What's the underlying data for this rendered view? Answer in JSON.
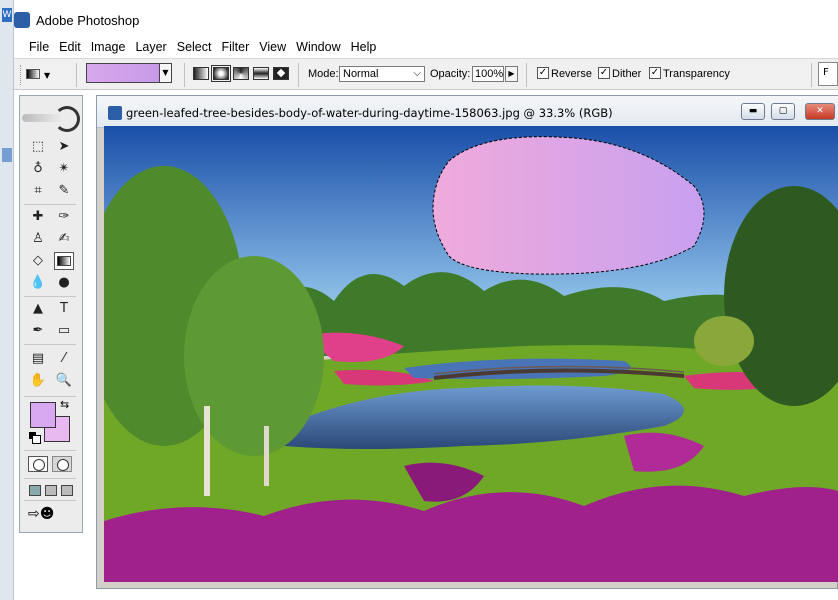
{
  "app": {
    "title": "Adobe Photoshop"
  },
  "menubar": {
    "items": [
      "File",
      "Edit",
      "Image",
      "Layer",
      "Select",
      "Filter",
      "View",
      "Window",
      "Help"
    ]
  },
  "options": {
    "mode_label": "Mode:",
    "mode_value": "Normal",
    "opacity_label": "Opacity:",
    "opacity_value": "100%",
    "reverse_label": "Reverse",
    "dither_label": "Dither",
    "transparency_label": "Transparency",
    "reverse_checked": true,
    "dither_checked": true,
    "transparency_checked": true,
    "palette_well_label": "F"
  },
  "toolbox": {
    "foreground_color": "#d8a8f0",
    "background_color": "#e8b8f0"
  },
  "document": {
    "title": "green-leafed-tree-besides-body-of-water-during-daytime-158063.jpg @ 33.3% (RGB)",
    "selection_fill_start": "#f0aadc",
    "selection_fill_end": "#c8a0f0"
  },
  "colors": {
    "sky_top": "#1a4fa8",
    "sky_bottom": "#9fd1f2",
    "grass": "#6fa826",
    "water": "#3a5fa0",
    "flowers": "#a0208c"
  }
}
